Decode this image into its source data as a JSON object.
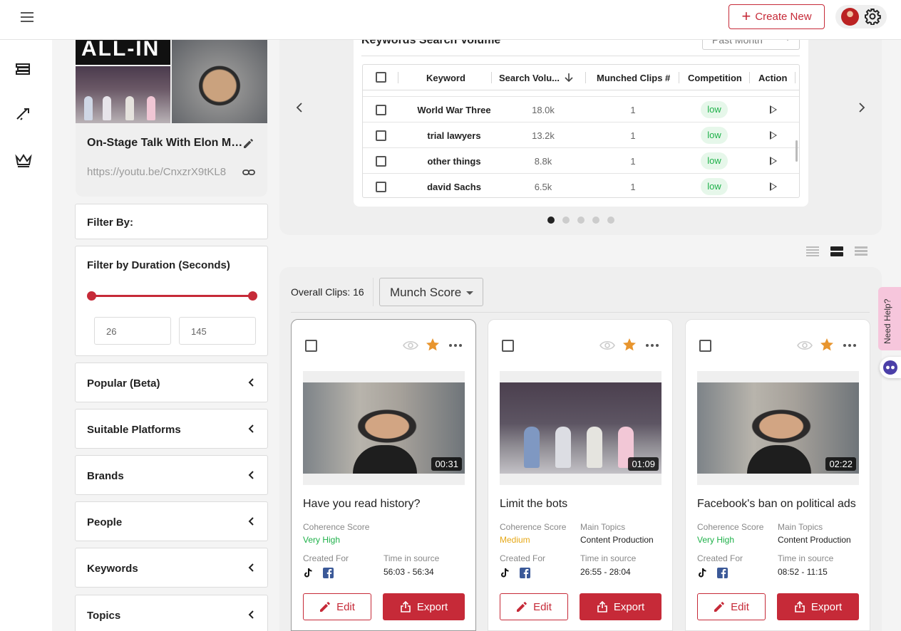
{
  "header": {
    "create_label": "Create New",
    "menu_icon": "hamburger-icon",
    "settings_icon": "gear-icon"
  },
  "rail": {
    "items": [
      "layers-icon",
      "rocket-icon",
      "crown-icon"
    ]
  },
  "video": {
    "title": "On-Stage Talk With Elon Musk",
    "url": "https://youtu.be/CnxzrX9tKL8",
    "banner_text": "ALL-IN"
  },
  "filters": {
    "filter_by": "Filter By:",
    "duration_title": "Filter by Duration (Seconds)",
    "duration_min": "26",
    "duration_max": "145",
    "duration_range": [
      0,
      1
    ],
    "sections": [
      "Popular (Beta)",
      "Suitable Platforms",
      "Brands",
      "People",
      "Keywords",
      "Topics"
    ]
  },
  "keywords": {
    "title": "Keywords Search Volume",
    "period": "Past Month",
    "columns": [
      "Keyword",
      "Search Volu...",
      "Munched Clips #",
      "Competition",
      "Action"
    ],
    "rows": [
      {
        "keyword": "World War Three",
        "volume": "18.0k",
        "clips": "1",
        "competition": "low"
      },
      {
        "keyword": "trial lawyers",
        "volume": "13.2k",
        "clips": "1",
        "competition": "low"
      },
      {
        "keyword": "other things",
        "volume": "8.8k",
        "clips": "1",
        "competition": "low"
      },
      {
        "keyword": "david Sachs",
        "volume": "6.5k",
        "clips": "1",
        "competition": "low"
      }
    ],
    "page_count": 5,
    "active_page": 1
  },
  "clips": {
    "overall_label": "Overall Clips: 16",
    "sort": "Munch Score",
    "items": [
      {
        "title": "Have you read history?",
        "duration": "00:31",
        "coherence_label": "Coherence Score",
        "coherence": "Very High",
        "topics_label": "",
        "topics": "",
        "created_label": "Created For",
        "time_label": "Time in source",
        "time": "56:03 - 56:34",
        "edit": "Edit",
        "export": "Export"
      },
      {
        "title": "Limit the bots",
        "duration": "01:09",
        "coherence_label": "Coherence Score",
        "coherence": "Medium",
        "topics_label": "Main Topics",
        "topics": "Content Production",
        "created_label": "Created For",
        "time_label": "Time in source",
        "time": "26:55 - 28:04",
        "edit": "Edit",
        "export": "Export"
      },
      {
        "title": "Facebook's ban on political ads",
        "duration": "02:22",
        "coherence_label": "Coherence Score",
        "coherence": "Very High",
        "topics_label": "Main Topics",
        "topics": "Content Production",
        "created_label": "Created For",
        "time_label": "Time in source",
        "time": "08:52 - 11:15",
        "edit": "Edit",
        "export": "Export"
      }
    ]
  },
  "help": {
    "label": "Need Help?"
  },
  "colors": {
    "accent": "#c62a38",
    "very_high": "#1fb14a",
    "medium": "#e6a817",
    "low_bg": "#e6f7ea"
  }
}
